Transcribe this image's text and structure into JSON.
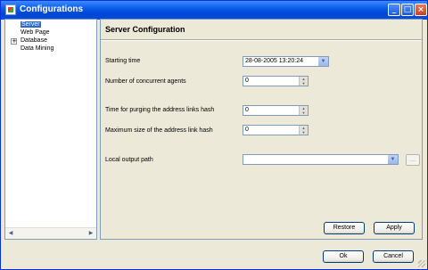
{
  "window": {
    "title": "Configurations",
    "minimize_icon": "minimize-icon",
    "maximize_icon": "maximize-icon",
    "close_icon": "close-icon"
  },
  "tree": {
    "items": [
      {
        "label": "Server",
        "selected": true
      },
      {
        "label": "Web Page"
      },
      {
        "label": "Database",
        "expandable": true
      },
      {
        "label": "Data Mining"
      }
    ]
  },
  "panel": {
    "title": "Server Configuration",
    "fields": {
      "starting_time": {
        "label": "Starting time",
        "value": "28-08-2005 13:20:24"
      },
      "concurrent_agents": {
        "label": "Number of concurrent agents",
        "value": "0"
      },
      "purge_time": {
        "label": "Time for purging the address links  hash",
        "value": "0"
      },
      "max_hash_size": {
        "label": "Maximum size of the address link hash",
        "value": "0"
      },
      "output_path": {
        "label": "Local output path",
        "value": ""
      }
    },
    "browse_label": "...",
    "buttons": {
      "restore": "Restore",
      "apply": "Apply"
    }
  },
  "footer": {
    "ok": "Ok",
    "cancel": "Cancel"
  }
}
